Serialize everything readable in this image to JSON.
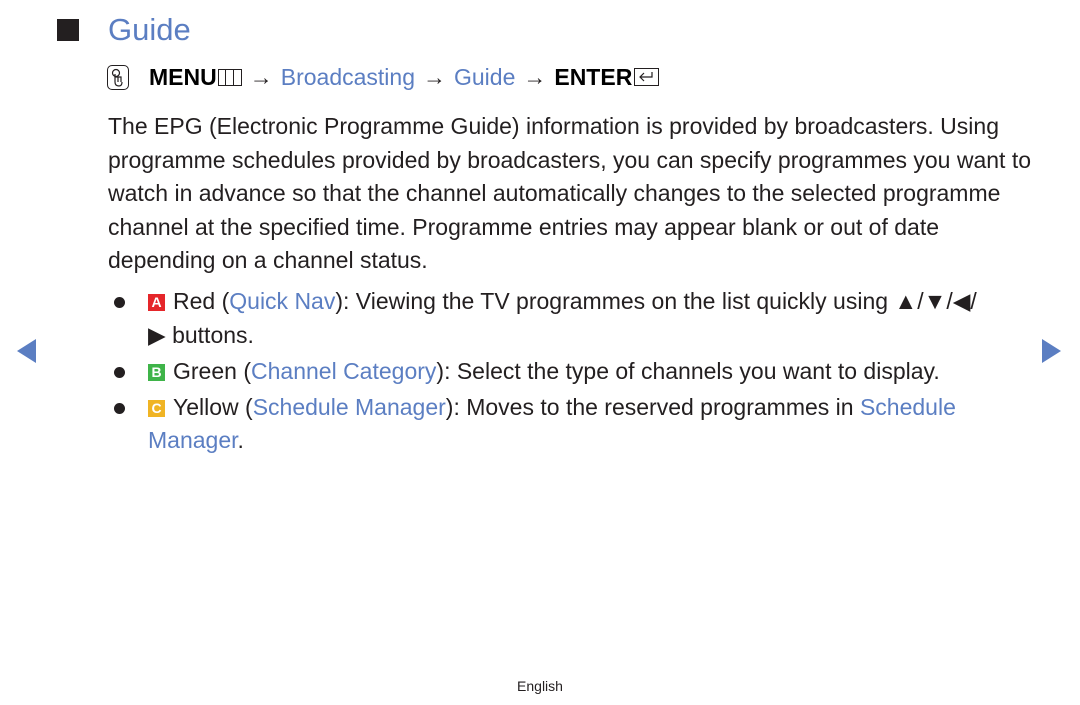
{
  "heading": {
    "title": "Guide"
  },
  "path": {
    "icon": "remote-hand-icon",
    "menu_label": "MENU",
    "menu_icon": "menu-grid-icon",
    "arrow": "→",
    "item1": "Broadcasting",
    "item2": "Guide",
    "enter_label": "ENTER",
    "enter_icon": "enter-return-icon"
  },
  "paragraph": "The EPG (Electronic Programme Guide) information is provided by broadcasters. Using programme schedules provided by broadcasters, you can specify programmes you want to watch in advance so that the channel automatically changes to the selected programme channel at the specified time. Programme entries may appear blank or out of date depending on a channel status.",
  "bullets": [
    {
      "key": "A",
      "color_name": "Red",
      "open": " (",
      "link": "Quick Nav",
      "rest": "): Viewing the TV programmes on the list quickly using ▲/▼/◀/▶ buttons.",
      "key_color": "#e5262a"
    },
    {
      "key": "B",
      "color_name": "Green",
      "open": " (",
      "link": "Channel Category",
      "rest": "): Select the type of channels you want to display.",
      "key_color": "#3fb449"
    },
    {
      "key": "C",
      "color_name": "Yellow",
      "open": " (",
      "link": "Schedule Manager",
      "rest": "): Moves to the reserved programmes in ",
      "link2": "Schedule Manager",
      "end": ".",
      "key_color": "#f0b424"
    }
  ],
  "nav": {
    "prev": "previous-page",
    "next": "next-page"
  },
  "footer": {
    "language": "English"
  },
  "colors": {
    "accent": "#5b7ec2",
    "text": "#231f20"
  }
}
